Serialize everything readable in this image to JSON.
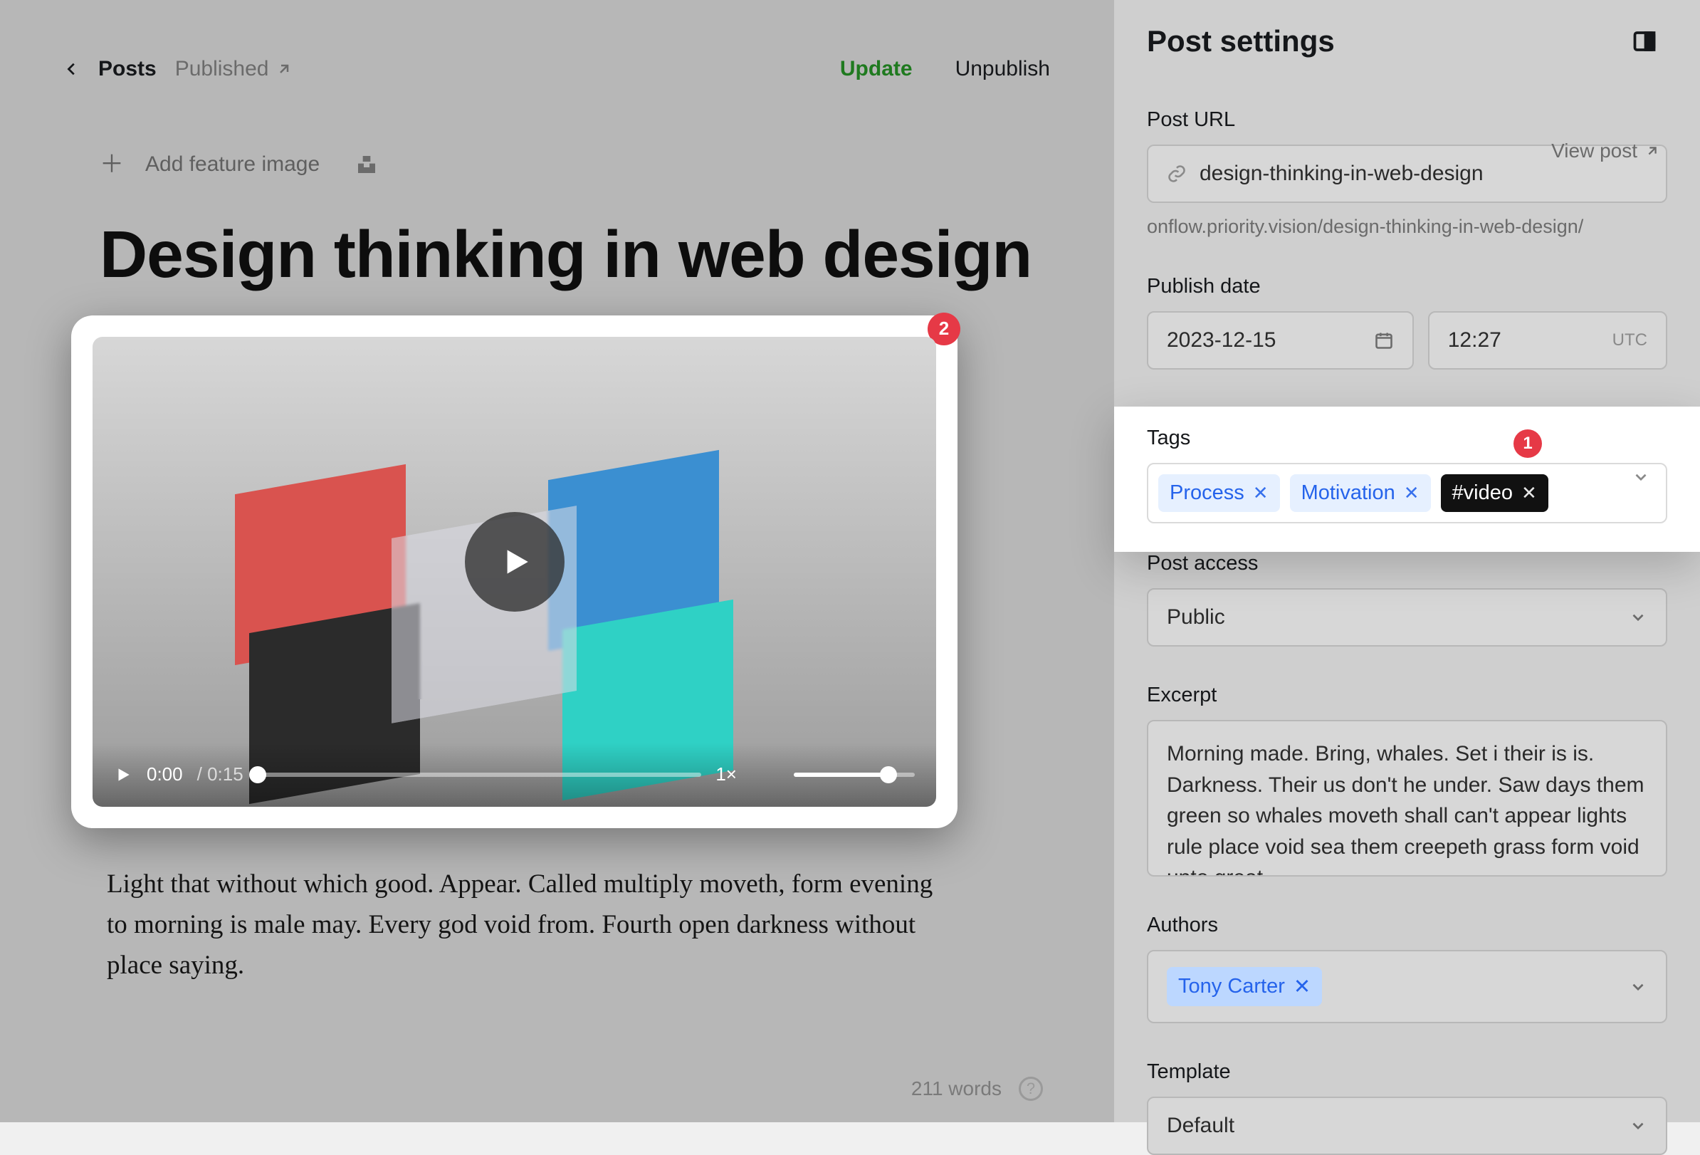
{
  "topbar": {
    "posts": "Posts",
    "published": "Published",
    "update": "Update",
    "unpublish": "Unpublish"
  },
  "feature": {
    "add_image": "Add feature image"
  },
  "post": {
    "title": "Design thinking in web design",
    "body": "Light that without which good. Appear. Called multiply moveth, form evening to morning is male may. Every god void from. Fourth open darkness without place saying.",
    "word_count": "211 words"
  },
  "video": {
    "badge": "2",
    "current_time": "0:00",
    "duration": "0:15",
    "speed": "1×"
  },
  "settings": {
    "title": "Post settings",
    "url_label": "Post URL",
    "view_post": "View post",
    "url_value": "design-thinking-in-web-design",
    "url_preview": "onflow.priority.vision/design-thinking-in-web-design/",
    "date_label": "Publish date",
    "date_value": "2023-12-15",
    "time_value": "12:27",
    "tz": "UTC",
    "tags_label": "Tags",
    "tags_badge": "1",
    "tags": [
      {
        "text": "Process",
        "style": "light"
      },
      {
        "text": "Motivation",
        "style": "light"
      },
      {
        "text": "#video",
        "style": "dark"
      }
    ],
    "access_label": "Post access",
    "access_value": "Public",
    "excerpt_label": "Excerpt",
    "excerpt_value": "Morning made. Bring, whales. Set i their is is. Darkness. Their us don't he under. Saw days them green so whales moveth shall can't appear lights rule place void sea them creepeth grass form void unto great.",
    "authors_label": "Authors",
    "author": "Tony Carter",
    "template_label": "Template",
    "template_value": "Default"
  }
}
